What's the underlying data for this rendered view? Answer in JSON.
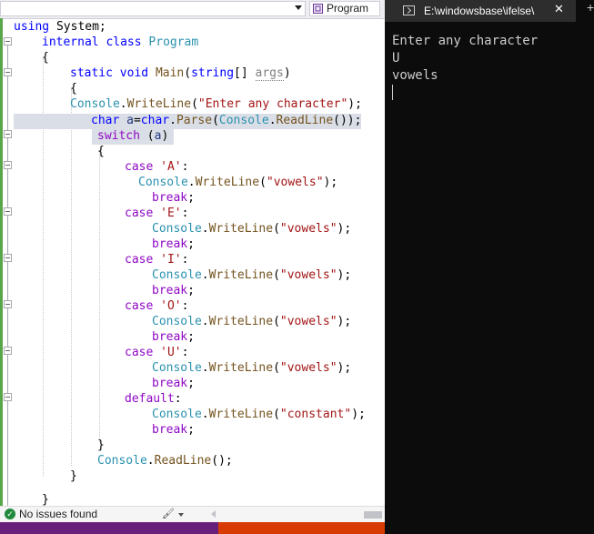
{
  "editor": {
    "class_dropdown": "Program",
    "status": "No issues found",
    "code": {
      "l1_using": "using",
      "l1_rest": " System;",
      "l2_internal": "internal",
      "l2_class": " class ",
      "l2_name": "Program",
      "l3": "{",
      "l4_static": "static",
      "l4_void": " void ",
      "l4_main": "Main",
      "l4_open": "(",
      "l4_string": "string",
      "l4_arr": "[] ",
      "l4_args": "args",
      "l4_close": ")",
      "l5": "{",
      "l6_console": "Console",
      "l6_dot": ".",
      "l6_writeline": "WriteLine",
      "l6_open": "(",
      "l6_str": "\"Enter any character\"",
      "l6_close": ");",
      "l7_char": "char",
      "l7_space": " ",
      "l7_a": "a",
      "l7_eq": "=",
      "l7_char2": "char",
      "l7_dot": ".",
      "l7_parse": "Parse",
      "l7_open": "(",
      "l7_console": "Console",
      "l7_dot2": ".",
      "l7_readline": "ReadLine",
      "l7_close": "());",
      "l8_switch": "switch",
      "l8_open": " (",
      "l8_a": "a",
      "l8_close": ")",
      "l9": "{",
      "case_kw": "case",
      "break_kw": "break",
      "semi": ";",
      "colon": ":",
      "ca": " 'A'",
      "ce": " 'E'",
      "ci": " 'I'",
      "co": " 'O'",
      "cu": " 'U'",
      "console": "Console",
      "dot": ".",
      "writeline": "WriteLine",
      "open": "(",
      "close": ");",
      "vowels_str": "\"vowels\"",
      "default_kw": "default",
      "constant_str": "\"constant\"",
      "l27": "}",
      "l28_console": "Console",
      "l28_dot": ".",
      "l28_readline": "ReadLine",
      "l28_close": "();",
      "l29": "}",
      "l30": "}"
    }
  },
  "console": {
    "title": "E:\\windowsbase\\ifelse\\",
    "close": "✕",
    "new_tab": "+",
    "lines": [
      "Enter any character",
      "U",
      "vowels"
    ]
  },
  "colors": {
    "keyword": "#0000ff",
    "type": "#2b91af",
    "method": "#74531f",
    "string": "#a31515",
    "control": "#8f08c4",
    "variable": "#1f377f",
    "console_bg": "#0c0c0c"
  }
}
